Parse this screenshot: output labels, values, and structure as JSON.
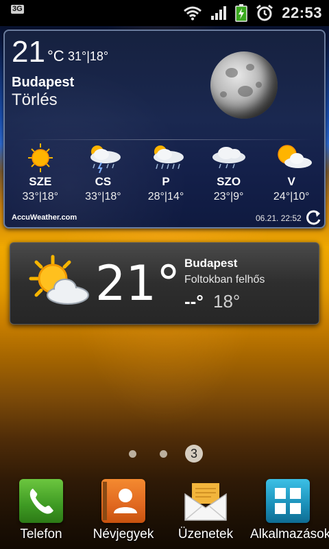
{
  "status_bar": {
    "network": "3G",
    "time": "22:53",
    "icons": [
      "3g-signal-icon",
      "wifi-icon",
      "signal-bars-icon",
      "battery-charging-icon",
      "alarm-clock-icon"
    ]
  },
  "accuweather_widget": {
    "temp": "21",
    "unit": "°C",
    "hilo": "31°|18°",
    "city": "Budapest",
    "district": "Törlés",
    "current_icon": "moon-icon",
    "forecast": [
      {
        "day": "SZE",
        "range": "33°|18°",
        "icon": "sunny-icon"
      },
      {
        "day": "CS",
        "range": "33°|18°",
        "icon": "thunderstorm-sun-icon"
      },
      {
        "day": "P",
        "range": "28°|14°",
        "icon": "rain-sun-icon"
      },
      {
        "day": "SZO",
        "range": "23°|9°",
        "icon": "cloud-rain-icon"
      },
      {
        "day": "V",
        "range": "24°|10°",
        "icon": "partly-cloudy-icon"
      }
    ],
    "logo": "AccuWeather.com",
    "updated": "06.21. 22:52"
  },
  "weather_widget": {
    "temp": "21°",
    "city": "Budapest",
    "condition": "Foltokban felhős",
    "high": "--°",
    "low": "18°",
    "icon": "partly-cloudy-icon"
  },
  "pager": {
    "current_page": "3"
  },
  "dock": [
    {
      "label": "Telefon",
      "icon": "phone-icon",
      "color": "#3e9a23"
    },
    {
      "label": "Névjegyek",
      "icon": "contacts-icon",
      "color": "#e06820"
    },
    {
      "label": "Üzenetek",
      "icon": "envelope-icon",
      "color": "#f3f3f3"
    },
    {
      "label": "Alkalmazások",
      "icon": "apps-grid-icon",
      "color": "#1a8fb8"
    }
  ]
}
